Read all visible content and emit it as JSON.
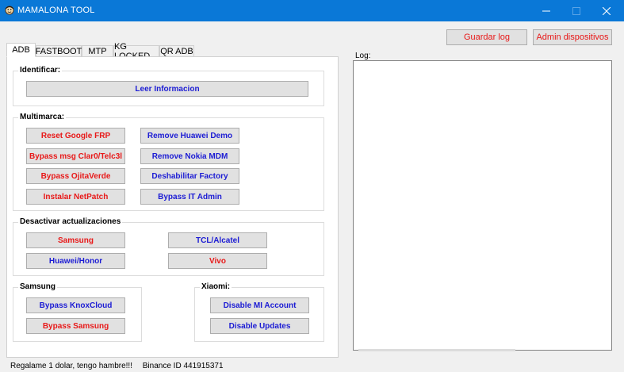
{
  "window": {
    "title": "MAMALONA TOOL",
    "icon": "app-logo-icon",
    "accent": "#0a78d7"
  },
  "toolbar": {
    "guardar_log": "Guardar log",
    "admin_dispositivos": "Admin dispositivos"
  },
  "tabs": [
    "ADB",
    "FASTBOOT",
    "MTP",
    "KG LOCKED",
    "QR ADB"
  ],
  "active_tab": "ADB",
  "identificar": {
    "title": "Identificar:",
    "leer": "Leer Informacion"
  },
  "multimarca": {
    "title": "Multimarca:",
    "left": [
      "Reset Google FRP",
      "Bypass msg Clar0/Telc3l",
      "Bypass OjitaVerde",
      "Instalar NetPatch"
    ],
    "right": [
      "Remove Huawei Demo",
      "Remove Nokia MDM",
      "Deshabilitar Factory",
      "Bypass IT Admin"
    ]
  },
  "desactivar": {
    "title": "Desactivar actualizaciones",
    "samsung": "Samsung",
    "huawei": "Huawei/Honor",
    "tcl": "TCL/Alcatel",
    "vivo": "Vivo"
  },
  "samsung": {
    "title": "Samsung",
    "knox": "Bypass KnoxCloud",
    "bypass": "Bypass Samsung"
  },
  "xiaomi": {
    "title": "Xiaomi:",
    "mi_account": "Disable MI Account",
    "updates": "Disable Updates"
  },
  "log": {
    "label": "Log:",
    "content": ""
  },
  "status": {
    "message": "Regalame 1 dolar, tengo hambre!!!",
    "binance": "Binance ID 441915371"
  },
  "colors": {
    "red_text": "#e81818",
    "blue_text": "#1c1cd4",
    "button_bg": "#e1e1e1"
  }
}
